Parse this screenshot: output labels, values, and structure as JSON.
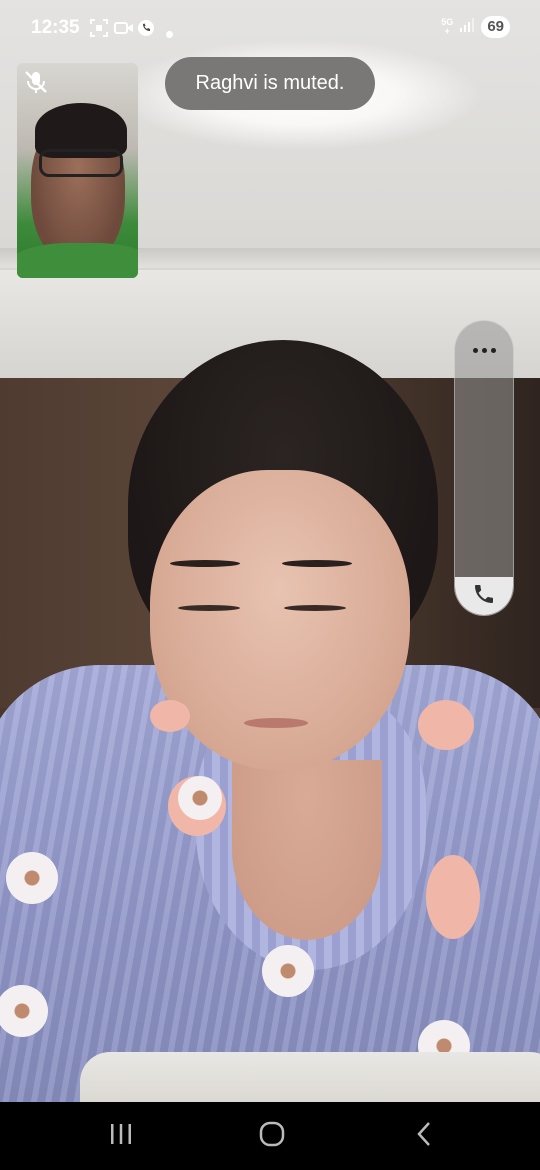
{
  "status_bar": {
    "time": "12:35",
    "network_label_top": "5G",
    "network_label_bottom": "+",
    "battery_level": "69",
    "icons": [
      "screenshot-icon",
      "video-icon",
      "call-status-icon",
      "notification-dot-icon",
      "network-5g-icon",
      "signal-icon",
      "battery-icon"
    ]
  },
  "call": {
    "toast_message": "Raghvi is muted.",
    "self_view_muted": true,
    "controls": {
      "more_icon": "more-horizontal-icon",
      "end_call_icon": "phone-icon"
    }
  },
  "navigation": {
    "icons": [
      "recent-apps-icon",
      "home-icon",
      "back-icon"
    ]
  },
  "colors": {
    "toast_background": "#7a7876",
    "controls_background": "#969696",
    "nav_background": "#000000"
  }
}
